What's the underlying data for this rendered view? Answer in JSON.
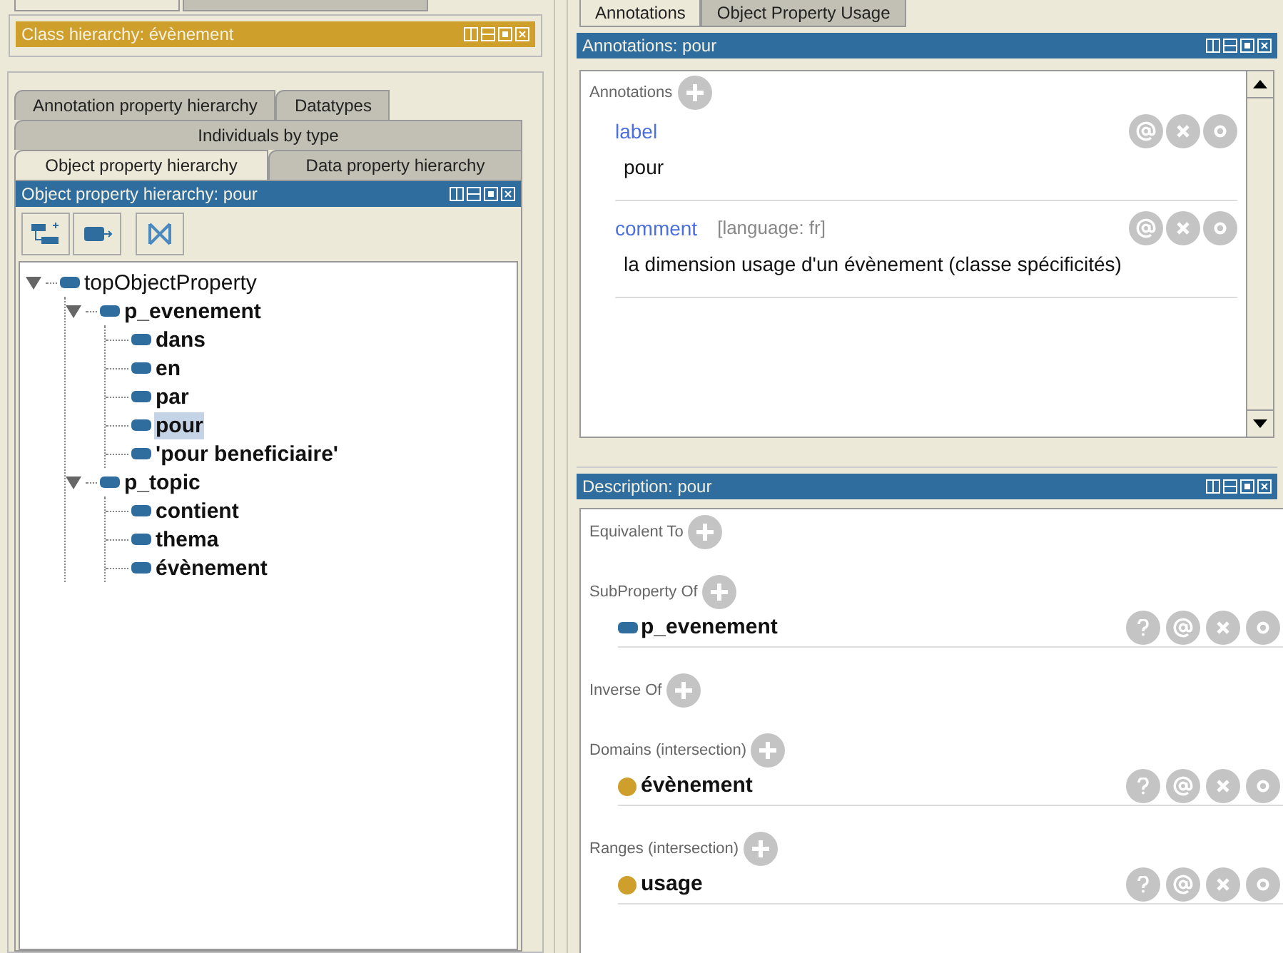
{
  "class_hierarchy_panel": {
    "title": "Class hierarchy: évènement"
  },
  "left_tab_rows": [
    {
      "tabs": [
        {
          "label": "Annotation property hierarchy",
          "selected": false
        },
        {
          "label": "Datatypes",
          "selected": false
        }
      ]
    },
    {
      "tabs": [
        {
          "label": "Individuals by type",
          "selected": false
        }
      ]
    },
    {
      "tabs": [
        {
          "label": "Object property hierarchy",
          "selected": true
        },
        {
          "label": "Data property hierarchy",
          "selected": false
        }
      ]
    }
  ],
  "object_property_panel": {
    "title": "Object property hierarchy: pour",
    "tree": [
      {
        "label": "topObjectProperty",
        "bold": false,
        "selected": false,
        "expanded": true,
        "children": [
          {
            "label": "p_evenement",
            "bold": true,
            "selected": false,
            "expanded": true,
            "children": [
              {
                "label": "dans",
                "bold": true,
                "selected": false
              },
              {
                "label": "en",
                "bold": true,
                "selected": false
              },
              {
                "label": "par",
                "bold": true,
                "selected": false
              },
              {
                "label": "pour",
                "bold": true,
                "selected": true
              },
              {
                "label": "'pour beneficiaire'",
                "bold": true,
                "selected": false
              }
            ]
          },
          {
            "label": "p_topic",
            "bold": true,
            "selected": false,
            "expanded": true,
            "children": [
              {
                "label": "contient",
                "bold": true,
                "selected": false
              },
              {
                "label": "thema",
                "bold": true,
                "selected": false
              },
              {
                "label": "évènement",
                "bold": true,
                "selected": false
              }
            ]
          }
        ]
      }
    ]
  },
  "right_tabs": [
    {
      "label": "Annotations",
      "selected": true
    },
    {
      "label": "Object Property Usage",
      "selected": false
    }
  ],
  "annotations_panel": {
    "title": "Annotations: pour",
    "section_label": "Annotations",
    "annotations": [
      {
        "property": "label",
        "value": "pour"
      },
      {
        "property": "comment",
        "language": "[language: fr]",
        "value": "la dimension usage d'un évènement (classe spécificités)"
      }
    ]
  },
  "description_panel": {
    "title": "Description: pour",
    "sections": [
      {
        "label": "Equivalent To"
      },
      {
        "label": "SubProperty Of",
        "items": [
          {
            "kind": "property",
            "label": "p_evenement"
          }
        ]
      },
      {
        "label": "Inverse Of"
      },
      {
        "label": "Domains (intersection)",
        "items": [
          {
            "kind": "class",
            "label": "évènement"
          }
        ]
      },
      {
        "label": "Ranges (intersection)",
        "items": [
          {
            "kind": "class",
            "label": "usage"
          }
        ]
      }
    ]
  }
}
